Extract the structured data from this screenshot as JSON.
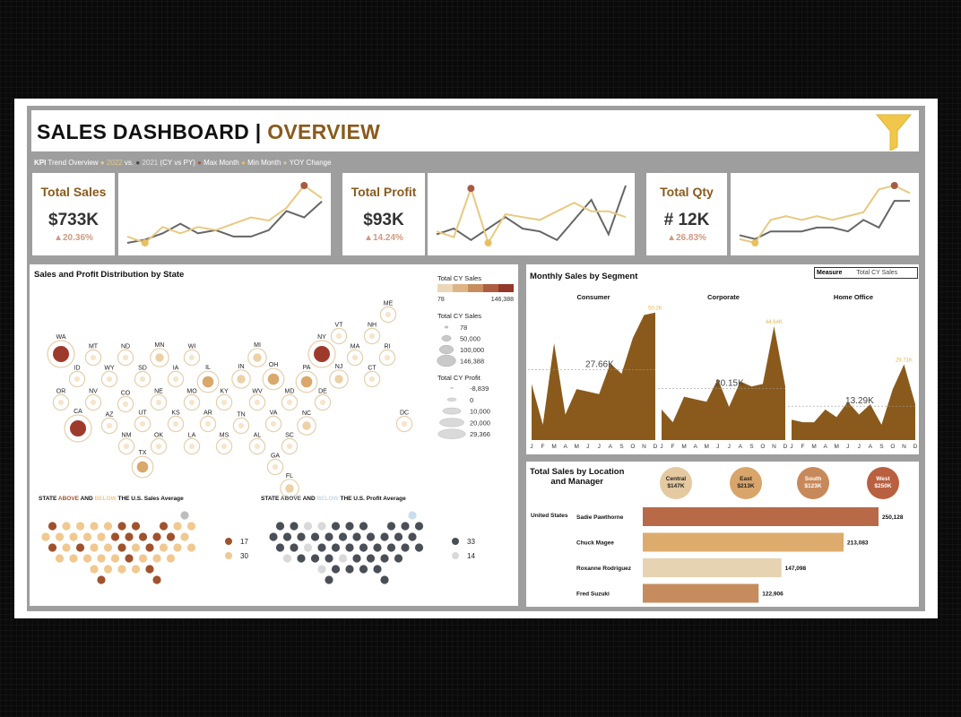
{
  "header": {
    "title_main": "SALES DASHBOARD | ",
    "title_accent": "OVERVIEW"
  },
  "trend_legend": {
    "kpi": "KPI",
    "text1": " Trend Overview ",
    "cy": "2022",
    "vs": " vs. ",
    "py": "2021",
    "text2": " (CY vs PY) ",
    "max": "Max Month",
    "min": "Min Month",
    "yoy": "YOY Change"
  },
  "kpis": [
    {
      "label": "Total Sales",
      "value": "$733K",
      "change": "▲20.36%",
      "cy": [
        3,
        1,
        6,
        4,
        6,
        5,
        7,
        9,
        8,
        12,
        19,
        15
      ],
      "py": [
        1,
        2,
        4,
        7,
        4,
        5,
        3,
        3,
        5,
        11,
        9,
        14
      ],
      "max_idx": 10,
      "min_idx": 1
    },
    {
      "label": "Total Profit",
      "value": "$93K",
      "change": "▲14.24%",
      "cy": [
        4,
        2,
        19,
        0,
        10,
        9,
        8,
        11,
        14,
        11,
        11,
        9
      ],
      "py": [
        3,
        5,
        1,
        5,
        9,
        5,
        4,
        1,
        8,
        15,
        3,
        20
      ],
      "max_idx": 2,
      "min_idx": 3
    },
    {
      "label": "Total Qty",
      "value": "# 12K",
      "change": "▲26.83%",
      "cy": [
        1,
        0,
        6,
        7,
        6,
        7,
        6,
        7,
        8,
        14,
        15,
        13
      ],
      "py": [
        2,
        1,
        3,
        3,
        3,
        4,
        4,
        3,
        6,
        4,
        11,
        11
      ],
      "max_idx": 10,
      "min_idx": 1
    }
  ],
  "colors": {
    "brand": "#8a5a1c",
    "cy_line": "#e9c980",
    "py_line": "#666666",
    "max_dot": "#a65a44",
    "min_dot": "#e8c060",
    "area_fill": "#8a5a1c",
    "above": "#a0522d",
    "below": "#f0c890",
    "profit_above": "#4a4f57",
    "profit_below": "#d9d9d9"
  },
  "map": {
    "title": "Sales and Profit Distribution by State",
    "states": [
      {
        "abbr": "ME",
        "sales": 1,
        "profit": 1
      },
      {
        "abbr": "VT",
        "sales": 1,
        "profit": 1
      },
      {
        "abbr": "NH",
        "sales": 1,
        "profit": 1
      },
      {
        "abbr": "WA",
        "sales": 5,
        "profit": 4
      },
      {
        "abbr": "MT",
        "sales": 1,
        "profit": 1
      },
      {
        "abbr": "ND",
        "sales": 1,
        "profit": 1
      },
      {
        "abbr": "MN",
        "sales": 2,
        "profit": 2
      },
      {
        "abbr": "WI",
        "sales": 1,
        "profit": 2
      },
      {
        "abbr": "MI",
        "sales": 2,
        "profit": 3
      },
      {
        "abbr": "NY",
        "sales": 5,
        "profit": 4
      },
      {
        "abbr": "MA",
        "sales": 1,
        "profit": 2
      },
      {
        "abbr": "RI",
        "sales": 1,
        "profit": 1
      },
      {
        "abbr": "ID",
        "sales": 1,
        "profit": 1
      },
      {
        "abbr": "WY",
        "sales": 1,
        "profit": 1
      },
      {
        "abbr": "SD",
        "sales": 1,
        "profit": 1
      },
      {
        "abbr": "IA",
        "sales": 1,
        "profit": 1
      },
      {
        "abbr": "IL",
        "sales": 3,
        "profit": 0
      },
      {
        "abbr": "IN",
        "sales": 2,
        "profit": 2
      },
      {
        "abbr": "OH",
        "sales": 3,
        "profit": 0
      },
      {
        "abbr": "PA",
        "sales": 3,
        "profit": 0
      },
      {
        "abbr": "NJ",
        "sales": 2,
        "profit": 2
      },
      {
        "abbr": "CT",
        "sales": 1,
        "profit": 2
      },
      {
        "abbr": "OR",
        "sales": 1,
        "profit": 1
      },
      {
        "abbr": "NV",
        "sales": 1,
        "profit": 1
      },
      {
        "abbr": "CO",
        "sales": 1,
        "profit": 0
      },
      {
        "abbr": "NE",
        "sales": 1,
        "profit": 1
      },
      {
        "abbr": "MO",
        "sales": 1,
        "profit": 1
      },
      {
        "abbr": "KY",
        "sales": 1,
        "profit": 1
      },
      {
        "abbr": "WV",
        "sales": 1,
        "profit": 1
      },
      {
        "abbr": "MD",
        "sales": 1,
        "profit": 1
      },
      {
        "abbr": "DE",
        "sales": 1,
        "profit": 1
      },
      {
        "abbr": "CA",
        "sales": 5,
        "profit": 4
      },
      {
        "abbr": "AZ",
        "sales": 1,
        "profit": 0
      },
      {
        "abbr": "UT",
        "sales": 1,
        "profit": 1
      },
      {
        "abbr": "KS",
        "sales": 1,
        "profit": 1
      },
      {
        "abbr": "AR",
        "sales": 1,
        "profit": 1
      },
      {
        "abbr": "TN",
        "sales": 1,
        "profit": 0
      },
      {
        "abbr": "VA",
        "sales": 1,
        "profit": 2
      },
      {
        "abbr": "NC",
        "sales": 2,
        "profit": 0
      },
      {
        "abbr": "DC",
        "sales": 1,
        "profit": 1
      },
      {
        "abbr": "NM",
        "sales": 1,
        "profit": 1
      },
      {
        "abbr": "OK",
        "sales": 1,
        "profit": 1
      },
      {
        "abbr": "LA",
        "sales": 1,
        "profit": 1
      },
      {
        "abbr": "MS",
        "sales": 1,
        "profit": 1
      },
      {
        "abbr": "AL",
        "sales": 1,
        "profit": 1
      },
      {
        "abbr": "SC",
        "sales": 1,
        "profit": 1
      },
      {
        "abbr": "GA",
        "sales": 1,
        "profit": 2
      },
      {
        "abbr": "TX",
        "sales": 3,
        "profit": 0
      },
      {
        "abbr": "FL",
        "sales": 2,
        "profit": 0
      }
    ],
    "legend": {
      "sales_title": "Total CY Sales",
      "sales_min": "78",
      "sales_max": "146,388",
      "size_title": "Total CY Sales",
      "size_values": [
        "78",
        "50,000",
        "100,000",
        "146,388"
      ],
      "profit_title": "Total CY Profit",
      "profit_values": [
        "-8,839",
        "0",
        "10,000",
        "20,000",
        "29,366"
      ]
    }
  },
  "hex_maps": [
    {
      "title_a": "STATE ",
      "title_above": "ABOVE",
      "title_b": " AND ",
      "title_below": "BELOW",
      "title_c": " THE U.S. Sales Average",
      "above_count": "17",
      "below_count": "30"
    },
    {
      "title_a": "STATE ",
      "title_above": "ABOVE",
      "title_b": " AND ",
      "title_below": "BELOW",
      "title_c": " THE U.S. Profit Average",
      "above_count": "33",
      "below_count": "14"
    }
  ],
  "segments": {
    "title": "Monthly Sales by Segment",
    "measure_label": "Measure",
    "measure_value": "Total CY Sales",
    "months": [
      "J",
      "F",
      "M",
      "A",
      "M",
      "J",
      "J",
      "A",
      "S",
      "O",
      "N",
      "D"
    ],
    "panels": [
      {
        "name": "Consumer",
        "avg_label": "27.66K",
        "avg": 27.66,
        "max_label": "50.2K",
        "values": [
          22,
          6,
          38,
          10,
          20,
          19,
          18,
          30,
          26,
          40,
          49,
          50
        ]
      },
      {
        "name": "Corporate",
        "avg_label": "20.15K",
        "avg": 20.15,
        "max_label": "44.64K",
        "values": [
          12,
          7,
          17,
          16,
          15,
          24,
          13,
          23,
          21,
          22,
          44.6,
          21
        ]
      },
      {
        "name": "Home Office",
        "avg_label": "13.29K",
        "avg": 13.29,
        "max_label": "29.71K",
        "values": [
          8,
          7,
          7,
          12,
          9,
          15,
          10,
          14,
          6,
          20,
          29.7,
          14
        ]
      }
    ]
  },
  "location": {
    "title_line1": "Total Sales by Location",
    "title_line2": "and Manager",
    "regions": [
      {
        "name": "Central",
        "value": "$147K",
        "color": "#e5c9a0"
      },
      {
        "name": "East",
        "value": "$213K",
        "color": "#d9a56b"
      },
      {
        "name": "South",
        "value": "$123K",
        "color": "#c8895a"
      },
      {
        "name": "West",
        "value": "$250K",
        "color": "#b86040"
      }
    ],
    "country": "United States",
    "managers": [
      {
        "name": "Sadie Pawthorne",
        "value": 250128,
        "label": "250,128",
        "color": "#b86a48"
      },
      {
        "name": "Chuck Magee",
        "value": 213083,
        "label": "213,083",
        "color": "#ddab6c"
      },
      {
        "name": "Roxanne Rodriguez",
        "value": 147098,
        "label": "147,098",
        "color": "#e6d3b2"
      },
      {
        "name": "Fred Suzuki",
        "value": 122906,
        "label": "122,906",
        "color": "#c68c5e"
      }
    ]
  },
  "chart_data": [
    {
      "type": "line",
      "title": "Total Sales",
      "x": [
        "J",
        "F",
        "M",
        "A",
        "M",
        "J",
        "J",
        "A",
        "S",
        "O",
        "N",
        "D"
      ],
      "series": [
        {
          "name": "2022",
          "values": [
            3,
            1,
            6,
            4,
            6,
            5,
            7,
            9,
            8,
            12,
            19,
            15
          ]
        },
        {
          "name": "2021",
          "values": [
            1,
            2,
            4,
            7,
            4,
            5,
            3,
            3,
            5,
            11,
            9,
            14
          ]
        }
      ]
    },
    {
      "type": "area",
      "title": "Monthly Sales by Segment",
      "x": [
        "J",
        "F",
        "M",
        "A",
        "M",
        "J",
        "J",
        "A",
        "S",
        "O",
        "N",
        "D"
      ],
      "series": [
        {
          "name": "Consumer",
          "values": [
            22,
            6,
            38,
            10,
            20,
            19,
            18,
            30,
            26,
            40,
            49,
            50
          ]
        },
        {
          "name": "Corporate",
          "values": [
            12,
            7,
            17,
            16,
            15,
            24,
            13,
            23,
            21,
            22,
            44.6,
            21
          ]
        },
        {
          "name": "Home Office",
          "values": [
            8,
            7,
            7,
            12,
            9,
            15,
            10,
            14,
            6,
            20,
            29.7,
            14
          ]
        }
      ]
    },
    {
      "type": "bar",
      "title": "Total Sales by Location and Manager",
      "categories": [
        "Sadie Pawthorne",
        "Chuck Magee",
        "Roxanne Rodriguez",
        "Fred Suzuki"
      ],
      "values": [
        250128,
        213083,
        147098,
        122906
      ]
    }
  ]
}
